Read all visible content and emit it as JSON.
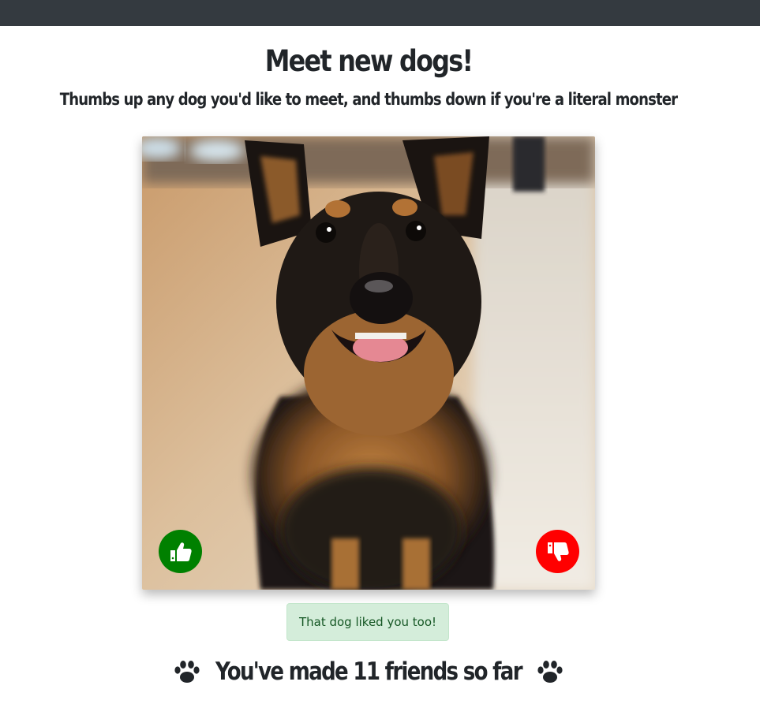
{
  "header": {
    "title": "Meet new dogs!",
    "subtitle": "Thumbs up any dog you'd like to meet, and thumbs down if you're a literal monster"
  },
  "card": {
    "like_icon": "thumbs-up-icon",
    "dislike_icon": "thumbs-down-icon"
  },
  "status": {
    "message": "That dog liked you too!"
  },
  "friends": {
    "text": "You've made 11 friends so far",
    "icon": "paw-icon"
  },
  "colors": {
    "navbar": "#343a40",
    "like": "#008000",
    "dislike": "#ff0000",
    "alert_bg": "#d4edda",
    "alert_text": "#155724"
  }
}
